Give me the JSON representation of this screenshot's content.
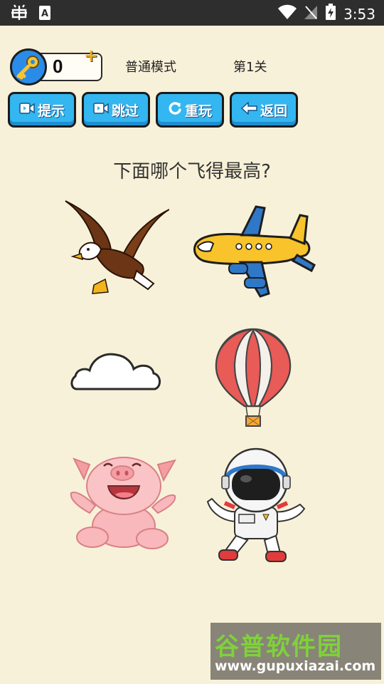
{
  "status_bar": {
    "time": "3:53",
    "icons": [
      "bug-icon",
      "keyboard-a-icon",
      "wifi-icon",
      "no-signal-icon",
      "battery-charging-icon"
    ]
  },
  "header": {
    "key_count": "0",
    "plus": "+",
    "mode_label": "普通模式",
    "level_label": "第1关"
  },
  "buttons": [
    {
      "label": "提示",
      "icon": "video-icon"
    },
    {
      "label": "跳过",
      "icon": "video-icon"
    },
    {
      "label": "重玩",
      "icon": "refresh-icon"
    },
    {
      "label": "返回",
      "icon": "back-arrow-icon"
    }
  ],
  "question": "下面哪个飞得最高?",
  "options": [
    {
      "name": "eagle"
    },
    {
      "name": "airplane"
    },
    {
      "name": "cloud"
    },
    {
      "name": "hot-air-balloon"
    },
    {
      "name": "pig"
    },
    {
      "name": "astronaut"
    }
  ],
  "watermark": {
    "title": "谷普软件园",
    "url": "www.gupuxiazai.com"
  },
  "colors": {
    "background": "#f8f1d9",
    "button": "#34b6f0",
    "key_circle": "#2b8be8"
  }
}
